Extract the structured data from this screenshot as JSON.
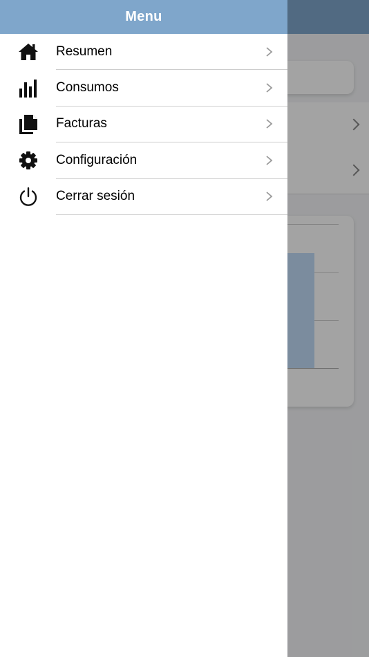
{
  "drawer": {
    "title": "Menu",
    "items": [
      {
        "label": "Resumen",
        "icon": "home-icon"
      },
      {
        "label": "Consumos",
        "icon": "bar-chart-icon"
      },
      {
        "label": "Facturas",
        "icon": "documents-icon"
      },
      {
        "label": "Configuración",
        "icon": "gear-icon"
      },
      {
        "label": "Cerrar sesión",
        "icon": "power-icon"
      }
    ]
  },
  "colors": {
    "header_bg": "#7fa6cb",
    "overlay": "rgba(0,0,0,0.36)",
    "divider": "#cdcdcd",
    "chevron": "#9a9a9a"
  }
}
